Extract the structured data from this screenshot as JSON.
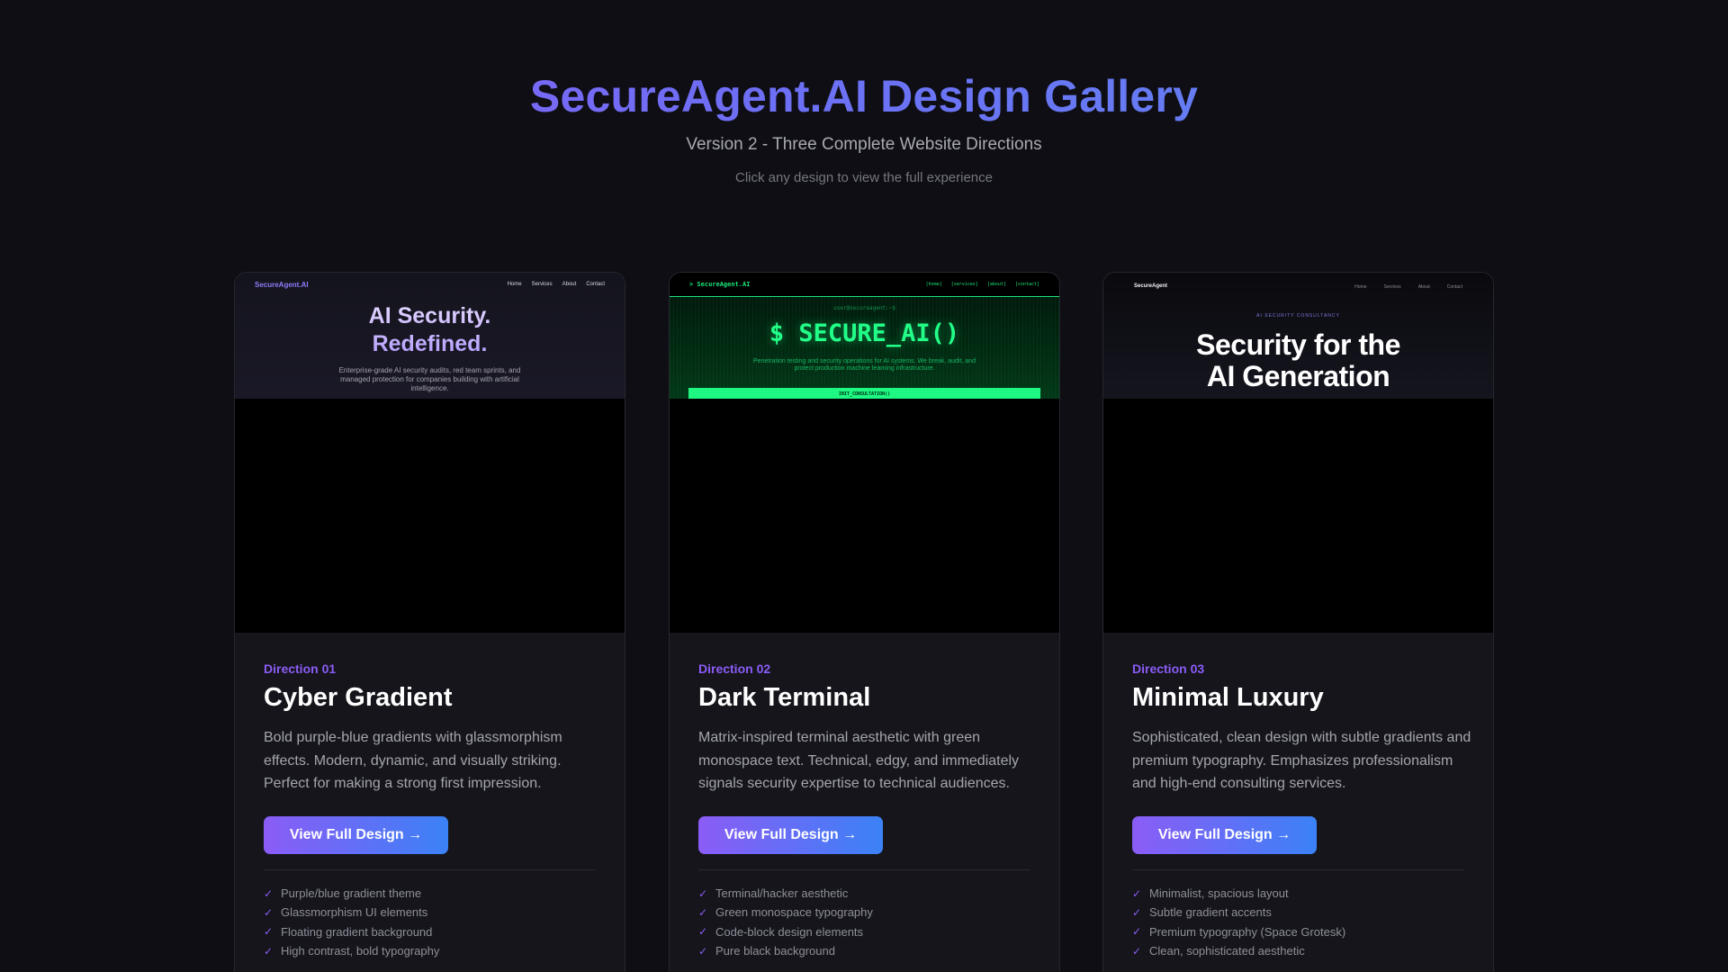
{
  "header": {
    "title": "SecureAgent.AI Design Gallery",
    "subtitle": "Version 2 - Three Complete Website Directions",
    "hint": "Click any design to view the full experience"
  },
  "colors": {
    "background": "#0e0e14",
    "card": "#15151b",
    "accent_purple": "#8b5cf6",
    "accent_blue": "#3b82f6",
    "terminal_green": "#22ff88"
  },
  "cards": [
    {
      "preview": {
        "logo": "SecureAgent.AI",
        "nav": [
          "Home",
          "Services",
          "About",
          "Contact"
        ],
        "hero_line1": "AI Security.",
        "hero_line2": "Redefined.",
        "hero_sub": "Enterprise-grade AI security audits, red team sprints, and managed protection for companies building with artificial intelligence."
      },
      "direction": "Direction 01",
      "name": "Cyber Gradient",
      "description": "Bold purple-blue gradients with glassmorphism effects. Modern, dynamic, and visually striking. Perfect for making a strong first impression.",
      "button": "View Full Design →",
      "features": [
        "Purple/blue gradient theme",
        "Glassmorphism UI elements",
        "Floating gradient background",
        "High contrast, bold typography"
      ]
    },
    {
      "preview": {
        "logo": "> SecureAgent.AI",
        "nav": [
          "[home]",
          "[services]",
          "[about]",
          "[contact]"
        ],
        "prompt": "user@secureagent:~$",
        "hero": "$ SECURE_AI()",
        "hero_sub": "Penetration testing and security operations for AI systems. We break, audit, and protect production machine learning infrastructure.",
        "cta": "INIT_CONSULTATION()"
      },
      "direction": "Direction 02",
      "name": "Dark Terminal",
      "description": "Matrix-inspired terminal aesthetic with green monospace text. Technical, edgy, and immediately signals security expertise to technical audiences.",
      "button": "View Full Design →",
      "features": [
        "Terminal/hacker aesthetic",
        "Green monospace typography",
        "Code-block design elements",
        "Pure black background"
      ]
    },
    {
      "preview": {
        "logo": "SecureAgent",
        "nav": [
          "Home",
          "Services",
          "About",
          "Contact"
        ],
        "eyebrow": "AI SECURITY CONSULTANCY",
        "hero_line1": "Security for the",
        "hero_line2": "AI Generation"
      },
      "direction": "Direction 03",
      "name": "Minimal Luxury",
      "description": "Sophisticated, clean design with subtle gradients and premium typography. Emphasizes professionalism and high-end consulting services.",
      "button": "View Full Design →",
      "features": [
        "Minimalist, spacious layout",
        "Subtle gradient accents",
        "Premium typography (Space Grotesk)",
        "Clean, sophisticated aesthetic"
      ]
    }
  ]
}
